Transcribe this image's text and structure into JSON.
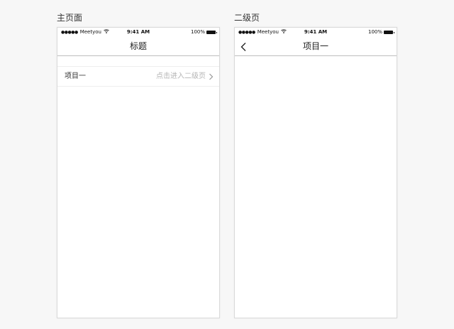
{
  "screens": [
    {
      "caption": "主页面",
      "status": {
        "carrier": "Meetyou",
        "time": "9:41 AM",
        "battery": "100%"
      },
      "nav_title": "标题",
      "list": [
        {
          "label": "项目一",
          "detail": "点击进入二级页"
        }
      ]
    },
    {
      "caption": "二级页",
      "status": {
        "carrier": "Meetyou",
        "time": "9:41 AM",
        "battery": "100%"
      },
      "nav_title": "项目一"
    }
  ],
  "icons": {
    "signal": "signal-dots-icon",
    "wifi": "wifi-icon",
    "battery": "battery-icon",
    "back": "chevron-left-icon",
    "disclosure": "chevron-right-icon"
  }
}
